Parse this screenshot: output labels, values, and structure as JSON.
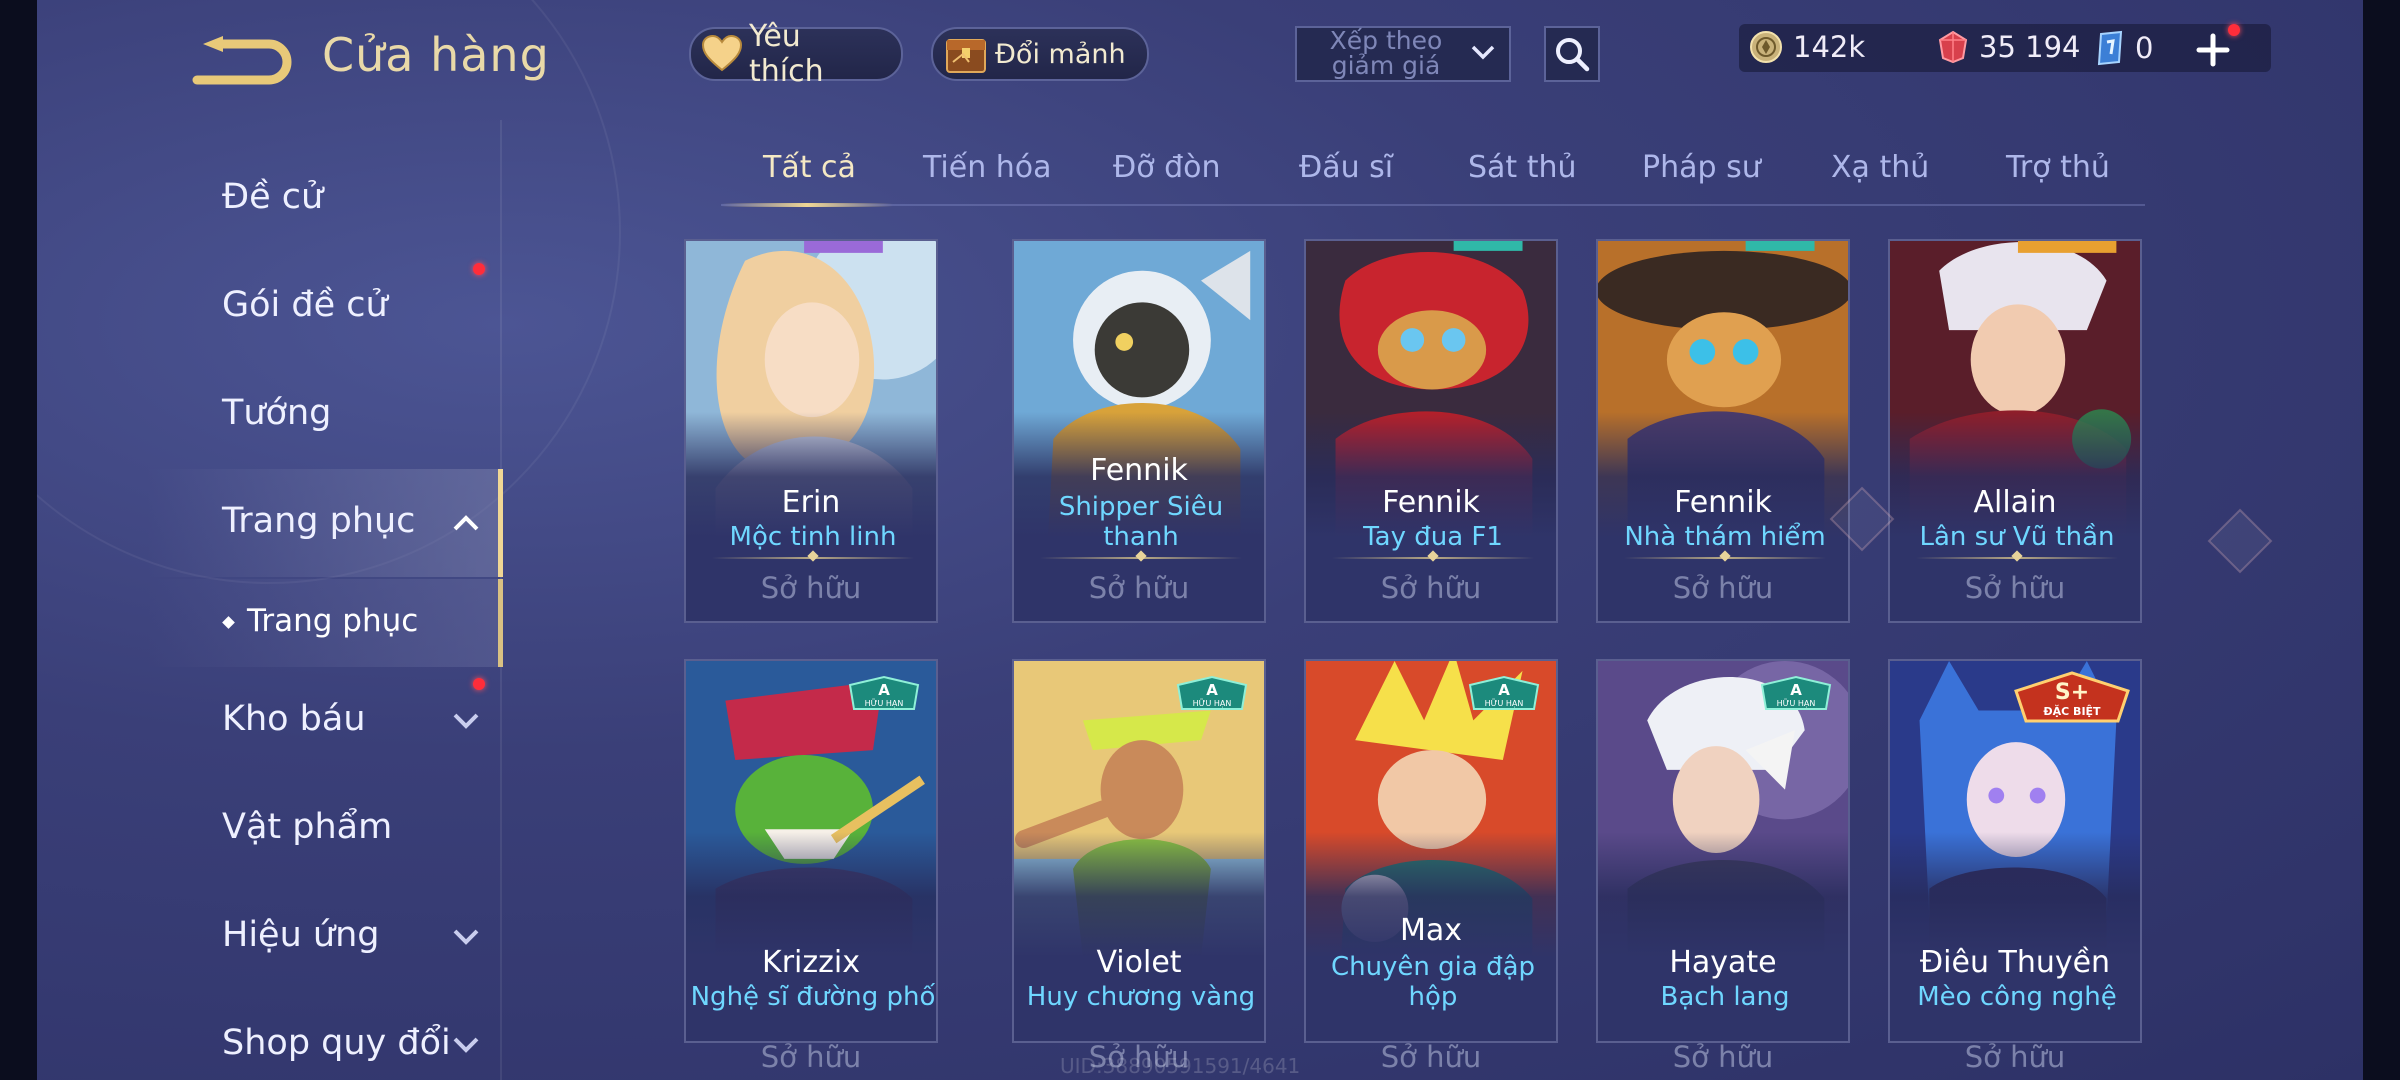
{
  "header": {
    "title": "Cửa hàng",
    "favorites_label": "Yêu thích",
    "exchange_label": "Đổi mảnh",
    "sort_label": "Xếp theo giảm giá"
  },
  "currency": {
    "gold": "142k",
    "gems": "35 194",
    "tickets": "0"
  },
  "sidebar": {
    "items": [
      {
        "label": "Đề cử"
      },
      {
        "label": "Gói đề cử"
      },
      {
        "label": "Tướng"
      },
      {
        "label": "Trang phục"
      },
      {
        "label": "Kho báu"
      },
      {
        "label": "Vật phẩm"
      },
      {
        "label": "Hiệu ứng"
      },
      {
        "label": "Shop quy đổi"
      }
    ],
    "sub_item": "Trang phục"
  },
  "tabs": [
    "Tất cả",
    "Tiến hóa",
    "Đỡ đòn",
    "Đấu sĩ",
    "Sát thủ",
    "Pháp sư",
    "Xạ thủ",
    "Trợ thủ"
  ],
  "cards": [
    {
      "hero": "Erin",
      "skin": "Mộc tinh linh",
      "status": "Sở hữu"
    },
    {
      "hero": "Fennik",
      "skin": "Shipper Siêu thanh",
      "status": "Sở hữu"
    },
    {
      "hero": "Fennik",
      "skin": "Tay đua F1",
      "status": "Sở hữu"
    },
    {
      "hero": "Fennik",
      "skin": "Nhà thám hiểm",
      "status": "Sở hữu"
    },
    {
      "hero": "Allain",
      "skin": "Lân sư Vũ thần",
      "status": "Sở hữu"
    },
    {
      "hero": "Krizzix",
      "skin": "Nghệ sĩ đường phố",
      "status": "Sở hữu",
      "badge": "A",
      "badge_sub": "HỮU HẠN"
    },
    {
      "hero": "Violet",
      "skin": "Huy chương vàng",
      "status": "Sở hữu",
      "badge": "A",
      "badge_sub": "HỮU HẠN"
    },
    {
      "hero": "Max",
      "skin": "Chuyên gia đập hộp",
      "status": "Sở hữu",
      "badge": "A",
      "badge_sub": "HỮU HẠN"
    },
    {
      "hero": "Hayate",
      "skin": "Bạch lang",
      "status": "Sở hữu",
      "badge": "A",
      "badge_sub": "HỮU HẠN"
    },
    {
      "hero": "Điêu Thuyền",
      "skin": "Mèo công nghệ",
      "status": "Sở hữu",
      "badge": "S+",
      "badge_sub": "ĐẶC BIỆT"
    }
  ],
  "watermark": "UID:38890591591/4641",
  "colors": {
    "background": "#3a3f78",
    "title_gold": "#e9d9a8",
    "skin_name_blue": "#6fd7ff",
    "owned_gray": "#7c82aa",
    "notification_red": "#ff2d3a"
  }
}
